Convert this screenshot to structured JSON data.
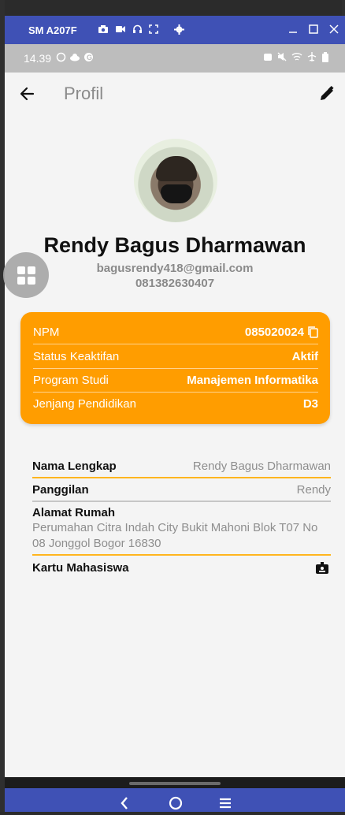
{
  "window": {
    "title": "SM A207F",
    "toolbar_icons": [
      "camera-icon",
      "video-icon",
      "headset-icon",
      "fullscreen-icon",
      "settings-icon"
    ],
    "controls": [
      "minimize-icon",
      "maximize-icon",
      "close-icon"
    ]
  },
  "statusbar": {
    "time": "14.39"
  },
  "appbar": {
    "title": "Profil"
  },
  "profile": {
    "name": "Rendy Bagus Dharmawan",
    "email": "bagusrendy418@gmail.com",
    "phone": "081382630407"
  },
  "academic_card": {
    "rows": [
      {
        "label": "NPM",
        "value": "085020024"
      },
      {
        "label": "Status Keaktifan",
        "value": "Aktif"
      },
      {
        "label": "Program Studi",
        "value": "Manajemen Informatika"
      },
      {
        "label": "Jenjang Pendidikan",
        "value": "D3"
      }
    ]
  },
  "details": {
    "full_name_label": "Nama Lengkap",
    "full_name_value": "Rendy Bagus Dharmawan",
    "nickname_label": "Panggilan",
    "nickname_value": "Rendy",
    "address_label": "Alamat Rumah",
    "address_value": "Perumahan Citra Indah City Bukit Mahoni Blok T07 No 08 Jonggol Bogor 16830",
    "student_card_label": "Kartu Mahasiswa"
  },
  "colors": {
    "accent": "#ff9d00",
    "window_bar": "#3f51b5",
    "statusbar": "#bdbdbd"
  }
}
